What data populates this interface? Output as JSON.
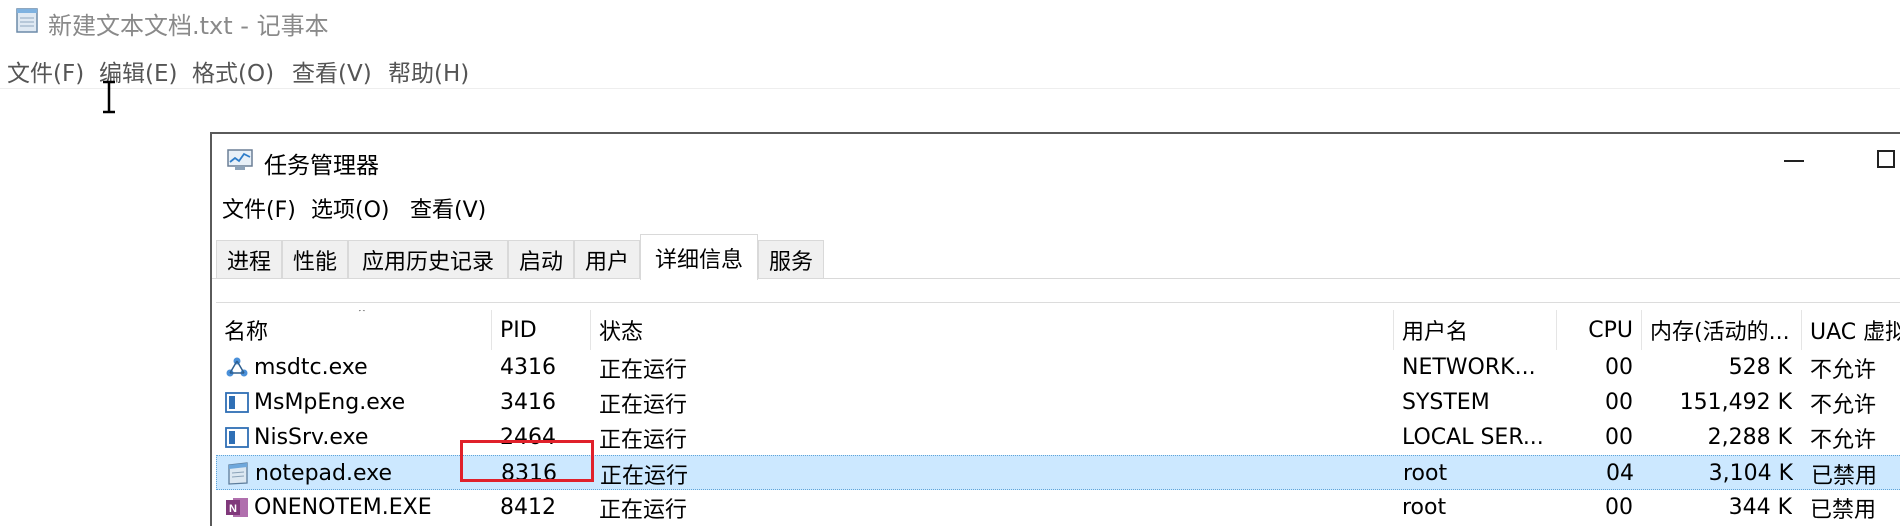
{
  "notepad": {
    "title": "新建文本文档.txt - 记事本",
    "menus": [
      "文件(F)",
      "编辑(E)",
      "格式(O)",
      "查看(V)",
      "帮助(H)"
    ]
  },
  "task_manager": {
    "title": "任务管理器",
    "menus": [
      "文件(F)",
      "选项(O)",
      "查看(V)"
    ],
    "tabs": [
      "进程",
      "性能",
      "应用历史记录",
      "启动",
      "用户",
      "详细信息",
      "服务"
    ],
    "active_tab": "详细信息",
    "columns": [
      "名称",
      "PID",
      "状态",
      "用户名",
      "CPU",
      "内存(活动的...",
      "UAC 虚拟化"
    ],
    "rows": [
      {
        "icon": "msdtc-icon",
        "name": "msdtc.exe",
        "pid": "4316",
        "status": "正在运行",
        "user": "NETWORK...",
        "cpu": "00",
        "memory": "528 K",
        "uac": "不允许"
      },
      {
        "icon": "defender-icon",
        "name": "MsMpEng.exe",
        "pid": "3416",
        "status": "正在运行",
        "user": "SYSTEM",
        "cpu": "00",
        "memory": "151,492 K",
        "uac": "不允许"
      },
      {
        "icon": "defender-icon",
        "name": "NisSrv.exe",
        "pid": "2464",
        "status": "正在运行",
        "user": "LOCAL SER...",
        "cpu": "00",
        "memory": "2,288 K",
        "uac": "不允许"
      },
      {
        "icon": "notepad-icon",
        "name": "notepad.exe",
        "pid": "8316",
        "status": "正在运行",
        "user": "root",
        "cpu": "04",
        "memory": "3,104 K",
        "uac": "已禁用"
      },
      {
        "icon": "onenote-icon",
        "name": "ONENOTEM.EXE",
        "pid": "8412",
        "status": "正在运行",
        "user": "root",
        "cpu": "00",
        "memory": "344 K",
        "uac": "已禁用"
      }
    ],
    "selected_row": "notepad.exe"
  },
  "colors": {
    "selection": "#cce8ff",
    "highlight_box": "#e0202a",
    "onenote": "#80397b"
  }
}
